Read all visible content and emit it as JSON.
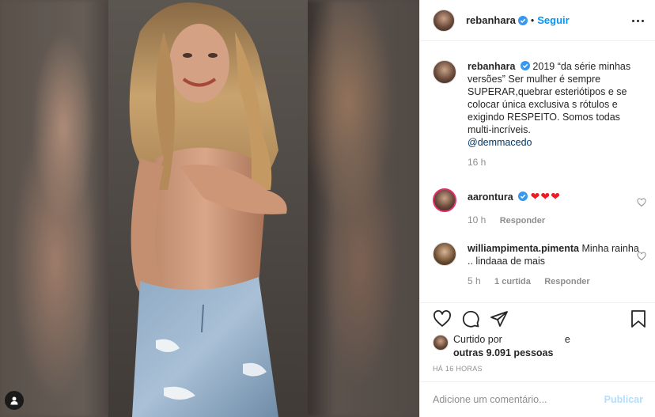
{
  "post": {
    "username": "rebanhara",
    "follow_label": "Seguir",
    "separator": "•"
  },
  "caption": {
    "username": "rebanhara",
    "text": "2019 “da série minhas versões” Ser mulher é sempre SUPERAR,quebrar esteriótipos e se colocar única exclusiva s rótulos e exigindo RESPEITO. Somos todas multi-incríveis.",
    "mention": "@demmacedo",
    "time": "16 h"
  },
  "comments": [
    {
      "username": "aarontura",
      "text": "❤❤❤",
      "time": "10 h",
      "reply_label": "Responder"
    },
    {
      "username": "williampimenta.pimenta",
      "text": "Minha rainha .. lindaaa de mais",
      "time": "5 h",
      "likes": "1 curtida",
      "reply_label": "Responder"
    }
  ],
  "likes": {
    "prefix": "Curtido por",
    "and": "e",
    "others": "outras 9.091 pessoas"
  },
  "timestamp": "HÁ 16 HORAS",
  "add_comment": {
    "placeholder": "Adicione um comentário...",
    "publish_label": "Publicar"
  },
  "icons": {
    "like": "heart-icon",
    "comment": "comment-icon",
    "share": "paper-plane-icon",
    "save": "bookmark-icon",
    "options": "more-options-icon",
    "tag": "user-tag-icon",
    "verified": "verified-badge-icon"
  },
  "colors": {
    "accent": "#0095f6",
    "verified": "#3897f0",
    "heart_red": "#ed1c24",
    "muted": "#8e8e8e",
    "publish_disabled": "#b2dffc"
  }
}
